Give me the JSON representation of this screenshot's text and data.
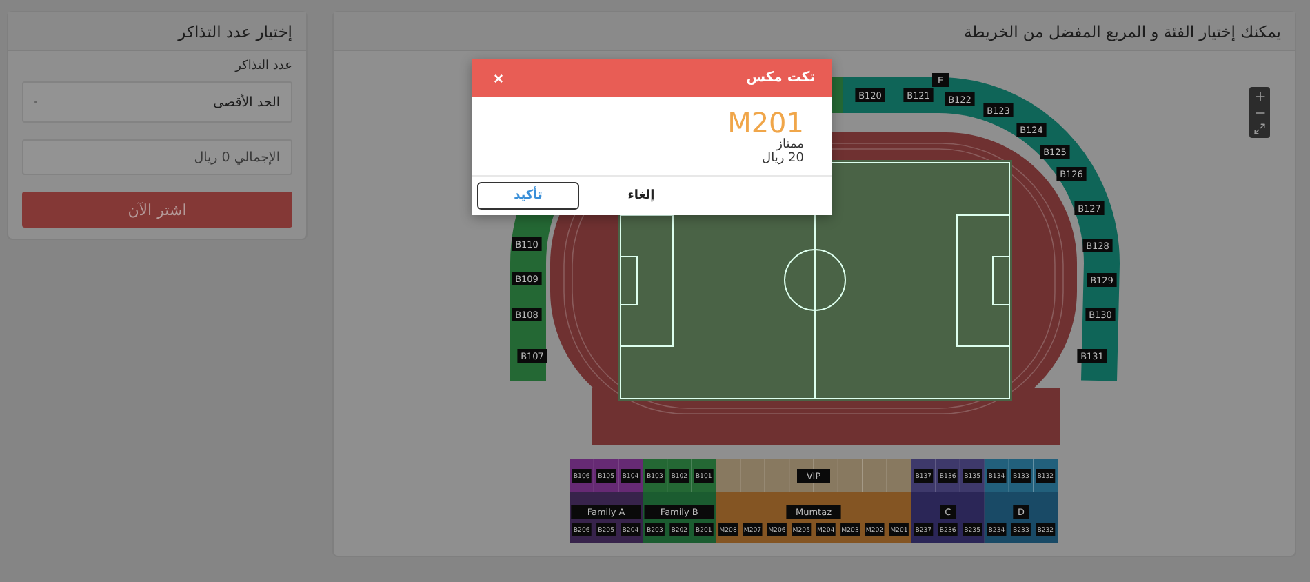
{
  "ticket_panel": {
    "title": "إختيار عدد التذاكر",
    "quantity_label": "عدد التذاكر",
    "quantity_select": {
      "value": "الحد الأقصى"
    },
    "total_field": {
      "placeholder": "الإجمالي 0 ريال"
    },
    "buy_button": {
      "label": "اشتر الآن",
      "disabled": true
    }
  },
  "map_panel": {
    "header": "يمكنك إختيار الفئة و المربع المفضل من الخريطة",
    "top_stand": {
      "label": "E",
      "sections": [
        "B120",
        "B121",
        "B122"
      ]
    },
    "right_stand": {
      "sections": [
        "B123",
        "B124",
        "B125",
        "B126",
        "B127",
        "B128",
        "B129",
        "B130",
        "B131"
      ]
    },
    "left_stand": {
      "sections": [
        "B110",
        "B109",
        "B108",
        "B107"
      ]
    },
    "upper_row": [
      {
        "color": "#662a74",
        "sections": [
          "B106",
          "B105",
          "B104"
        ]
      },
      {
        "color": "#246834",
        "sections": [
          "B103",
          "B102",
          "B101"
        ]
      },
      {
        "color": "#887960",
        "label": "VIP"
      },
      {
        "color": "#3e396b",
        "sections": [
          "B137",
          "B136",
          "B135"
        ]
      },
      {
        "color": "#22607c",
        "sections": [
          "B134",
          "B133",
          "B132"
        ]
      }
    ],
    "lower_row": [
      {
        "color": "#37234b",
        "label": "Family A",
        "sections": [
          "B206",
          "B205",
          "B204"
        ]
      },
      {
        "color": "#1b5c30",
        "label": "Family B",
        "sections": [
          "B203",
          "B202",
          "B201"
        ]
      },
      {
        "color": "#845523",
        "label": "Mumtaz",
        "sections": [
          "M208",
          "M207",
          "M206",
          "M205",
          "M204",
          "M203",
          "M202",
          "M201"
        ]
      },
      {
        "color": "#2b2657",
        "label": "C",
        "sections": [
          "B237",
          "B236",
          "B235"
        ]
      },
      {
        "color": "#194a66",
        "label": "D",
        "sections": [
          "B234",
          "B233",
          "B232"
        ]
      }
    ]
  },
  "modal": {
    "title": "تكت مكس",
    "close": "×",
    "code": "M201",
    "category": "ممتاز",
    "price": "20 ريال",
    "buttons": [
      {
        "label": "إلغاء",
        "kind": "plain"
      },
      {
        "label": "تأكيد",
        "kind": "primary"
      }
    ]
  }
}
